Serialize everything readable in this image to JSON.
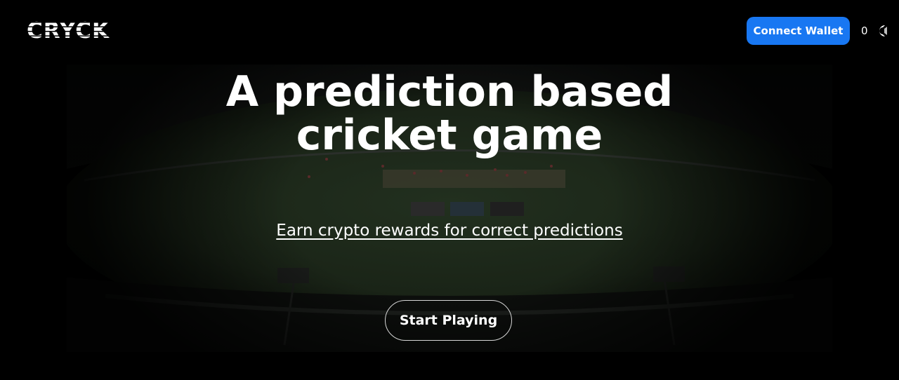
{
  "header": {
    "logo_text": "CRYCK",
    "connect_wallet_label": "Connect Wallet",
    "balance": "0",
    "balance_icon": "coin-icon"
  },
  "hero": {
    "title_line1": "A prediction based",
    "title_line2": "cricket game",
    "subtitle": "Earn crypto rewards for correct predictions",
    "cta_label": "Start Playing",
    "background": "cricket-stadium-image"
  },
  "colors": {
    "background": "#000000",
    "accent": "#1877f2",
    "text": "#ffffff"
  }
}
